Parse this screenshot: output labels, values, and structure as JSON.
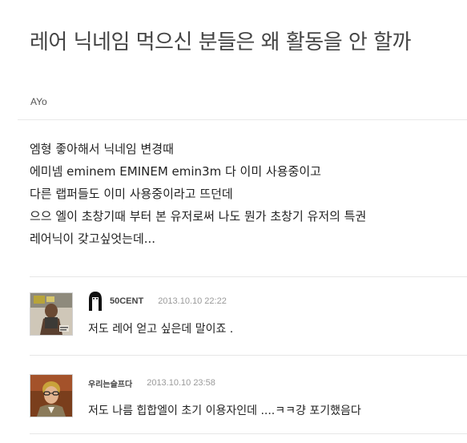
{
  "post": {
    "title": "레어 닉네임 먹으신 분들은 왜 활동을 안 할까",
    "author": "AYo",
    "body_lines": [
      "엠형 좋아해서 닉네임 변경때",
      "에미넴 eminem EMINEM emin3m 다 이미 사용중이고",
      "다른 랩퍼들도 이미 사용중이라고 뜨던데",
      "으으 엘이 초창기때 부터 본 유저로써 나도 뭔가 초창기 유저의 특권",
      "레어닉이 갖고싶엇는데..."
    ]
  },
  "comments": [
    {
      "nickname": "50CENT",
      "date": "2013.10.10 22:22",
      "text": "저도 레어 얻고 싶은데 말이죠 .",
      "avatar": "album-cover-avatar",
      "has_level_icon": true
    },
    {
      "nickname": "우리는슬프다",
      "date": "2013.10.10 23:58",
      "text": "저도 나름 힙합엘이 초기 이용자인데 ....ㅋㅋ걍 포기했음다",
      "avatar": "portrait-avatar",
      "has_level_icon": false
    }
  ]
}
